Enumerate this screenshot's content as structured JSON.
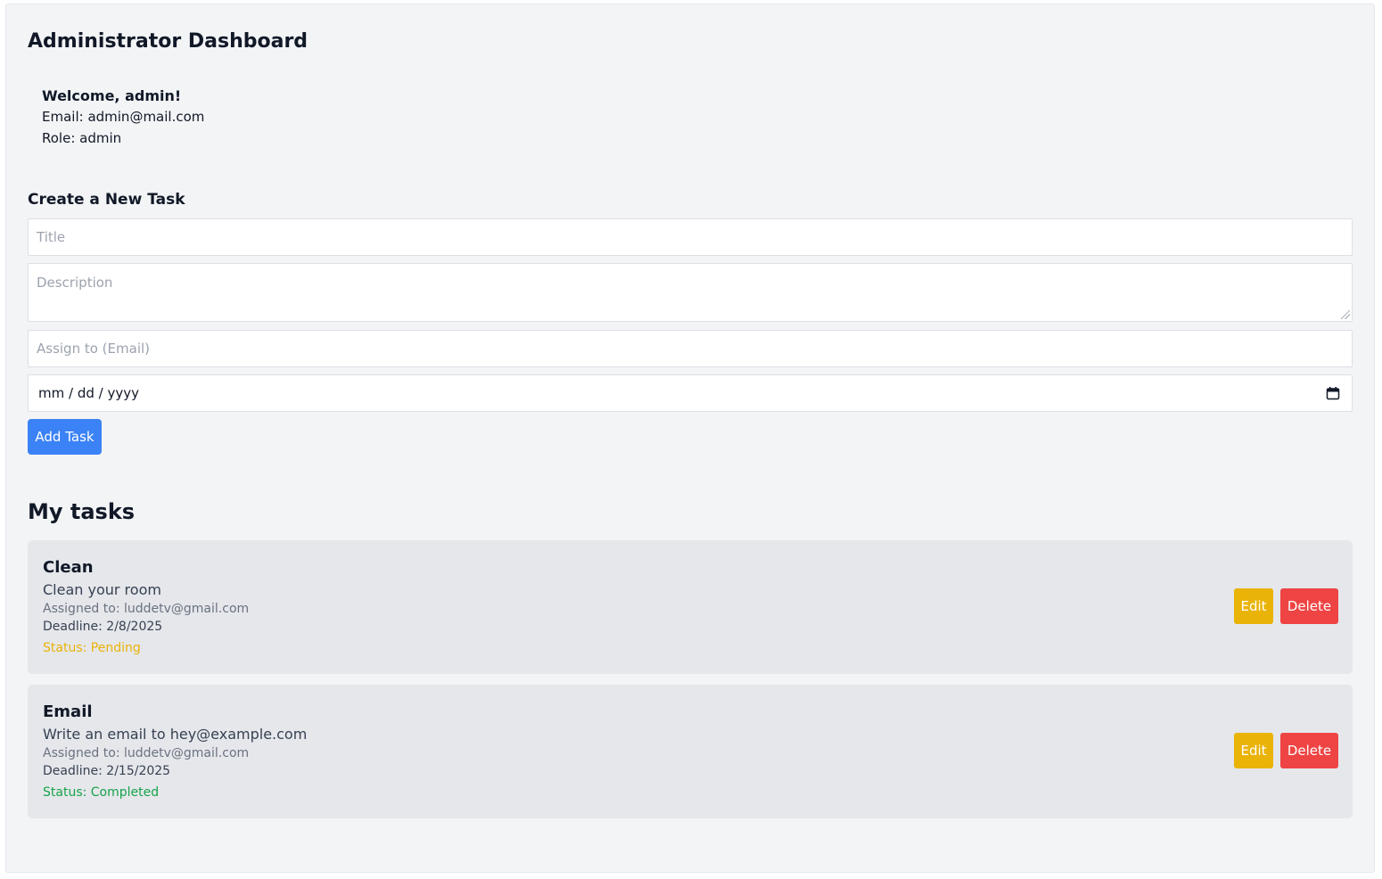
{
  "page": {
    "title": "Administrator Dashboard"
  },
  "user": {
    "welcome": "Welcome, admin!",
    "email_line": "Email: admin@mail.com",
    "role_line": "Role: admin"
  },
  "create_form": {
    "heading": "Create a New Task",
    "title_placeholder": "Title",
    "description_placeholder": "Description",
    "assign_placeholder": "Assign to (Email)",
    "date_value": "mm / dd / yyyy",
    "add_button": "Add Task",
    "calendar_icon": "calendar-icon"
  },
  "tasks_section": {
    "heading": "My tasks"
  },
  "tasks": [
    {
      "title": "Clean",
      "description": "Clean your room",
      "assigned": "Assigned to: luddetv@gmail.com",
      "deadline": "Deadline: 2/8/2025",
      "status": "Status: Pending",
      "status_color": "#eab308",
      "edit_label": "Edit",
      "delete_label": "Delete"
    },
    {
      "title": "Email",
      "description": "Write an email to hey@example.com",
      "assigned": "Assigned to: luddetv@gmail.com",
      "deadline": "Deadline: 2/15/2025",
      "status": "Status: Completed",
      "status_color": "#16a34a",
      "edit_label": "Edit",
      "delete_label": "Delete"
    }
  ],
  "colors": {
    "primary": "#3b82f6",
    "edit": "#eab308",
    "delete": "#ef4444",
    "panel": "#f3f4f6",
    "card": "#e5e7eb"
  }
}
